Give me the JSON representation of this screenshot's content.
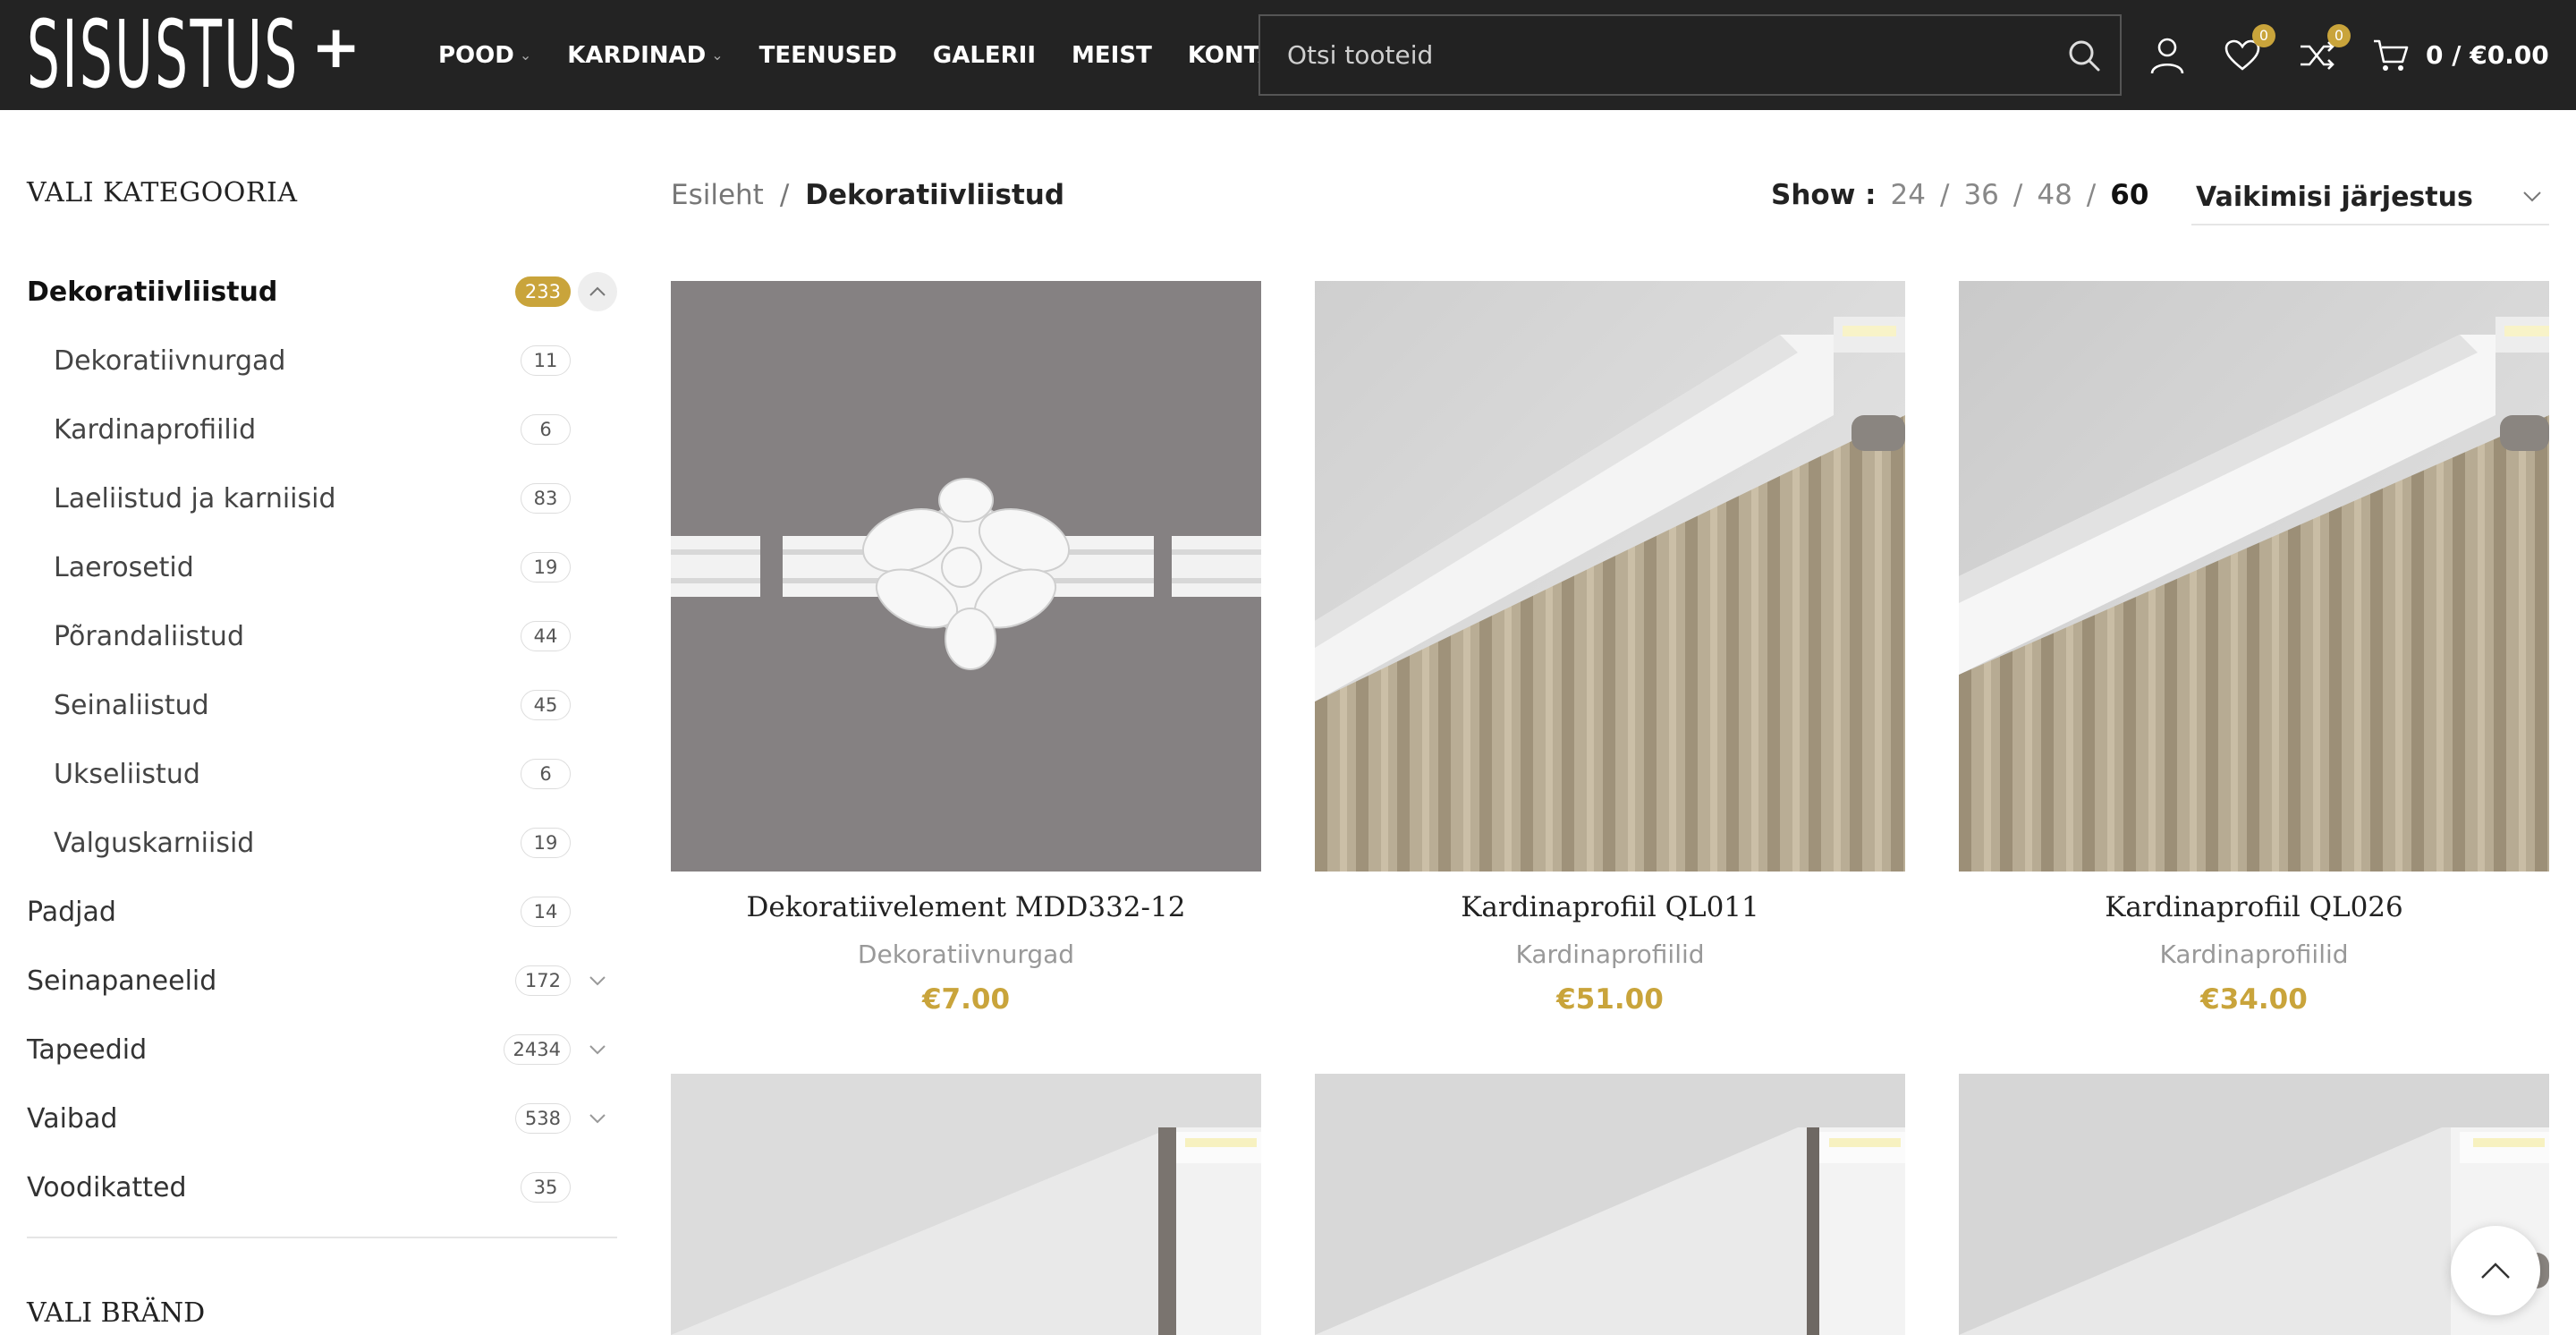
{
  "header": {
    "logo_text": "SISUSTUS",
    "logo_plus": "+",
    "nav": [
      {
        "label": "POOD",
        "has_dropdown": true
      },
      {
        "label": "KARDINAD",
        "has_dropdown": true
      },
      {
        "label": "TEENUSED",
        "has_dropdown": false
      },
      {
        "label": "GALERII",
        "has_dropdown": false
      },
      {
        "label": "MEIST",
        "has_dropdown": false
      },
      {
        "label": "KONTAKT",
        "has_dropdown": false
      }
    ],
    "search_placeholder": "Otsi tooteid",
    "wishlist_count": "0",
    "compare_count": "0",
    "cart_text": "0 / €0.00",
    "icons": [
      "user-icon",
      "heart-icon",
      "compare-icon",
      "cart-icon"
    ],
    "background": "#232323"
  },
  "sidebar": {
    "title": "VALI KATEGOORIA",
    "categories": [
      {
        "label": "Dekoratiivliistud",
        "count": "233",
        "active": true,
        "toggle": "up"
      },
      {
        "label": "Dekoratiivnurgad",
        "count": "11",
        "sub": true
      },
      {
        "label": "Kardinaprofiilid",
        "count": "6",
        "sub": true
      },
      {
        "label": "Laeliistud ja karniisid",
        "count": "83",
        "sub": true
      },
      {
        "label": "Laerosetid",
        "count": "19",
        "sub": true
      },
      {
        "label": "Põrandaliistud",
        "count": "44",
        "sub": true
      },
      {
        "label": "Seinaliistud",
        "count": "45",
        "sub": true
      },
      {
        "label": "Ukseliistud",
        "count": "6",
        "sub": true
      },
      {
        "label": "Valguskarniisid",
        "count": "19",
        "sub": true
      },
      {
        "label": "Padjad",
        "count": "14"
      },
      {
        "label": "Seinapaneelid",
        "count": "172",
        "toggle": "down"
      },
      {
        "label": "Tapeedid",
        "count": "2434",
        "toggle": "down"
      },
      {
        "label": "Vaibad",
        "count": "538",
        "toggle": "down"
      },
      {
        "label": "Voodikatted",
        "count": "35"
      }
    ],
    "brand_title": "VALI BRÄND"
  },
  "toolbar": {
    "breadcrumb_home": "Esileht",
    "breadcrumb_sep": "/",
    "breadcrumb_current": "Dekoratiivliistud",
    "show_label": "Show :",
    "show_options": [
      "24",
      "36",
      "48",
      "60"
    ],
    "show_selected": "60",
    "sort_label": "Vaikimisi järjestus"
  },
  "products": [
    {
      "title": "Dekoratiivelement MDD332-12",
      "category": "Dekoratiivnurgad",
      "price": "€7.00",
      "image": "ornament"
    },
    {
      "title": "Kardinaprofiil QL011",
      "category": "Kardinaprofiilid",
      "price": "€51.00",
      "image": "curtain-profile"
    },
    {
      "title": "Kardinaprofiil QL026",
      "category": "Kardinaprofiilid",
      "price": "€34.00",
      "image": "curtain-profile"
    },
    {
      "image": "ceiling-profile"
    },
    {
      "image": "ceiling-profile"
    },
    {
      "image": "ceiling-profile"
    }
  ],
  "colors": {
    "accent": "#c9a43b",
    "header_bg": "#232323",
    "text": "#222222",
    "muted": "#999999"
  }
}
